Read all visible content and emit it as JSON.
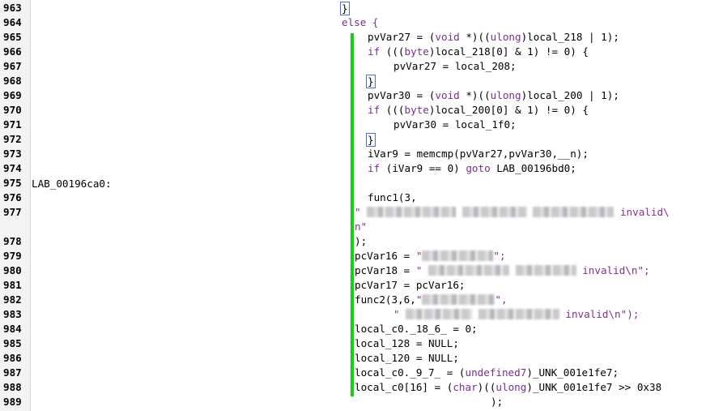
{
  "line_numbers": [
    "963",
    "964",
    "965",
    "966",
    "967",
    "968",
    "969",
    "970",
    "971",
    "972",
    "973",
    "974",
    "975",
    "976",
    "977",
    "978",
    "979",
    "980",
    "981",
    "982",
    "983",
    "984",
    "985",
    "986",
    "987",
    "988",
    "989"
  ],
  "labels": {
    "lab_975": "LAB_00196ca0:"
  },
  "code": {
    "l963": "}",
    "l964": "else {",
    "l965a": "pvVar27 = (",
    "l965kw": "void",
    "l965b": " *)((",
    "l965kw2": "ulong",
    "l965c": ")local_218 | 1);",
    "l966a": "if",
    "l966b": " (((",
    "l966kw": "byte",
    "l966c": ")local_218[0] & 1) != 0) {",
    "l967": "pvVar27 = local_208;",
    "l968": "}",
    "l969a": "pvVar30 = (",
    "l969kw": "void",
    "l969b": " *)((",
    "l969kw2": "ulong",
    "l969c": ")local_200 | 1);",
    "l970a": "if",
    "l970b": " (((",
    "l970kw": "byte",
    "l970c": ")local_200[0] & 1) != 0) {",
    "l971": "pvVar30 = local_1f0;",
    "l972": "}",
    "l973": "iVar9 = memcmp(pvVar27,pvVar30,__n);",
    "l974a": "if",
    "l974b": " (iVar9 == 0) ",
    "l974kw": "goto",
    "l974c": " LAB_00196bd0;",
    "l976": "func1(3,",
    "l977q": "\"",
    "l977s": "invalid\\",
    "l977n": "n\"",
    "l978": ");",
    "l979a": "pcVar16 = ",
    "l979q1": "\"",
    "l979q2": "\";",
    "l980a": "pcVar18 = ",
    "l980q1": "\"",
    "l980s": "invalid\\n\";",
    "l981": "pcVar17 = pcVar16;",
    "l982a": "func2(3,6,",
    "l982q1": "\"",
    "l982q2": "\",",
    "l983q1": "\"",
    "l983s": "invalid\\n\");",
    "l984": "local_c0._18_6_ = 0;",
    "l985": "local_128 = NULL;",
    "l986": "local_120 = NULL;",
    "l987a": "local_c0._9_7_ = (",
    "l987kw": "undefined7",
    "l987b": ")_UNK_001e1fe7;",
    "l988a": "local_c0[16] = (",
    "l988kw": "char",
    "l988b": ")((",
    "l988kw2": "ulong",
    "l988c": ")_UNK_001e1fe7 >> 0x38",
    "l989": ");"
  },
  "colors": {
    "keyword": "#7a2e8e",
    "bar": "#12d312",
    "gutter": "#f3f3f3"
  }
}
